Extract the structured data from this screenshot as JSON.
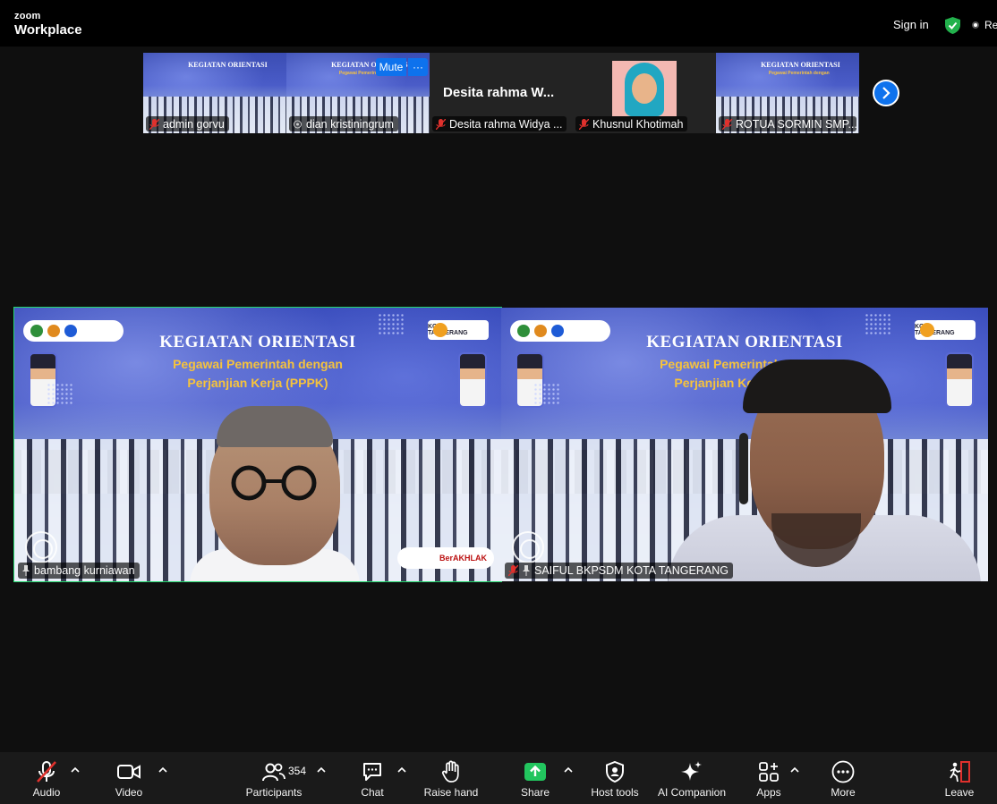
{
  "app": {
    "brand_top": "zoom",
    "brand_bottom": "Workplace"
  },
  "topbar": {
    "sign_in": "Sign in",
    "recording_label": "Re"
  },
  "gallery": {
    "thumbs": [
      {
        "name": "admin gorvu",
        "muted": true
      },
      {
        "name": "dian kristiningrum",
        "muted": false
      },
      {
        "name": "Desita rahma Widya ...",
        "display_name": "Desita rahma W...",
        "muted": true
      },
      {
        "name": "Khusnul Khotimah",
        "muted": true
      },
      {
        "name": "ROTUA SORMIN SMP...",
        "muted": true
      }
    ],
    "mute_button": "Mute",
    "more_button": "···"
  },
  "slide": {
    "title": "KEGIATAN ORIENTASI",
    "subtitle_line1": "Pegawai Pemerintah dengan",
    "subtitle_line2": "Perjanjian Kerja (PPPK)",
    "kota": "KOTA TANGERANG",
    "akhlak": "BerAKHLAK"
  },
  "videos": [
    {
      "name": "bambang kurniawan",
      "active": true,
      "muted": false
    },
    {
      "name": "SAIFUL BKPSDM KOTA TANGERANG",
      "active": false,
      "muted": true
    }
  ],
  "toolbar": {
    "audio": "Audio",
    "video": "Video",
    "participants": "Participants",
    "participants_count": "354",
    "chat": "Chat",
    "raise_hand": "Raise hand",
    "share": "Share",
    "host_tools": "Host tools",
    "ai_companion": "AI Companion",
    "apps": "Apps",
    "more": "More",
    "leave": "Leave"
  },
  "colors": {
    "accent_blue": "#0e72ed",
    "active_speaker": "#23d96e",
    "share_green": "#22c55e",
    "muted_red": "#e0312d"
  }
}
